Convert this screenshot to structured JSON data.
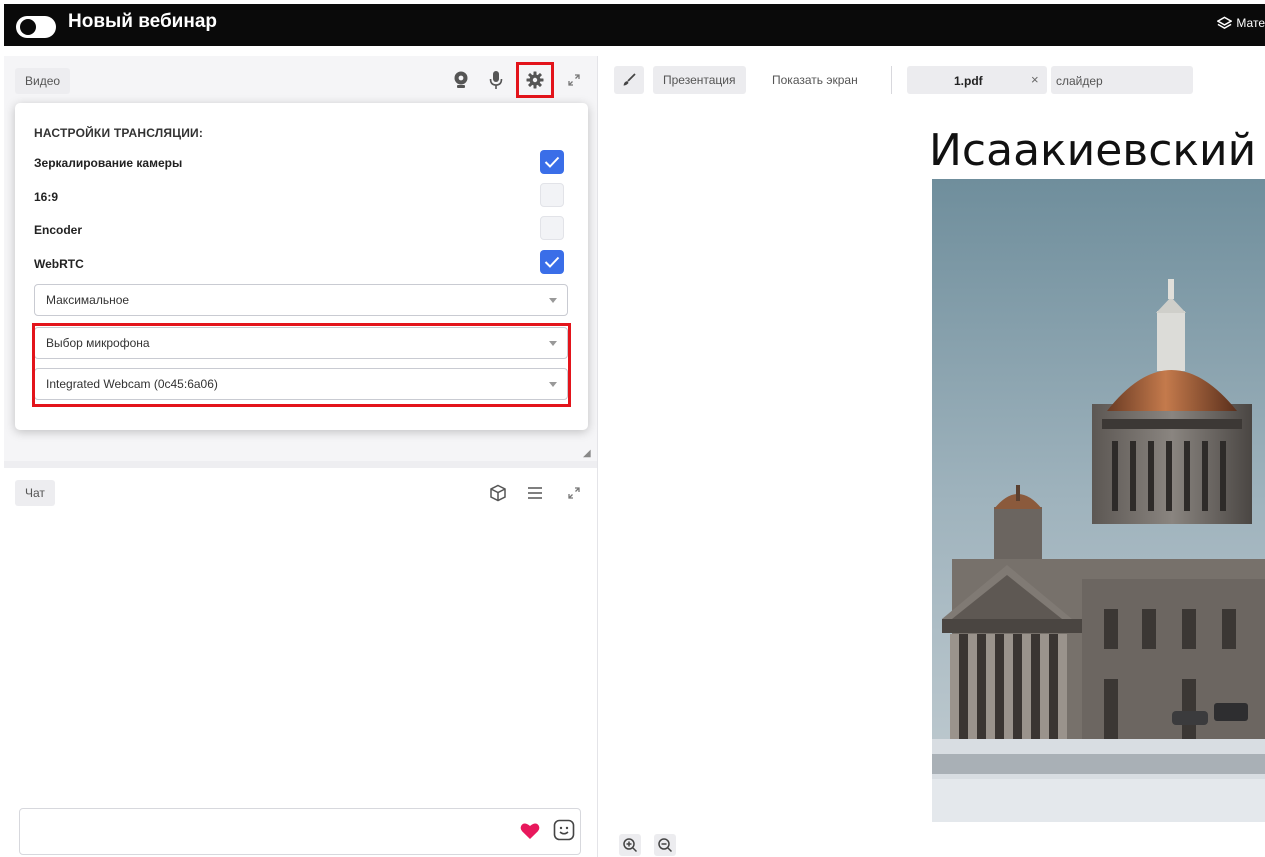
{
  "app": {
    "title": "Новый вебинар",
    "materials_label": "Мате"
  },
  "video_panel": {
    "tab_label": "Видео",
    "icons": [
      "camera-icon",
      "microphone-icon",
      "gear-icon",
      "expand-icon"
    ]
  },
  "settings": {
    "title": "НАСТРОЙКИ ТРАНСЛЯЦИИ:",
    "options": [
      {
        "label": "Зеркалирование камеры",
        "checked": true
      },
      {
        "label": "16:9",
        "checked": false
      },
      {
        "label": "Encoder",
        "checked": false
      },
      {
        "label": "WebRTC",
        "checked": true
      }
    ],
    "quality_select": "Максимальное",
    "microphone_select": "Выбор микрофона",
    "camera_select": "Integrated Webcam (0c45:6a06)"
  },
  "chat_panel": {
    "tab_label": "Чат",
    "icons": [
      "cube-icon",
      "menu-icon",
      "expand-icon"
    ],
    "input_placeholder": ""
  },
  "presentation": {
    "tabs": [
      "Презентация",
      "Показать экран"
    ],
    "file_name": "1.pdf",
    "close_symbol": "×",
    "slider_label": "слайдер",
    "slide_title": "Исаакиевский"
  },
  "colors": {
    "accent": "#3a6ee8",
    "highlight": "#e3141b",
    "heart": "#e8185c"
  }
}
